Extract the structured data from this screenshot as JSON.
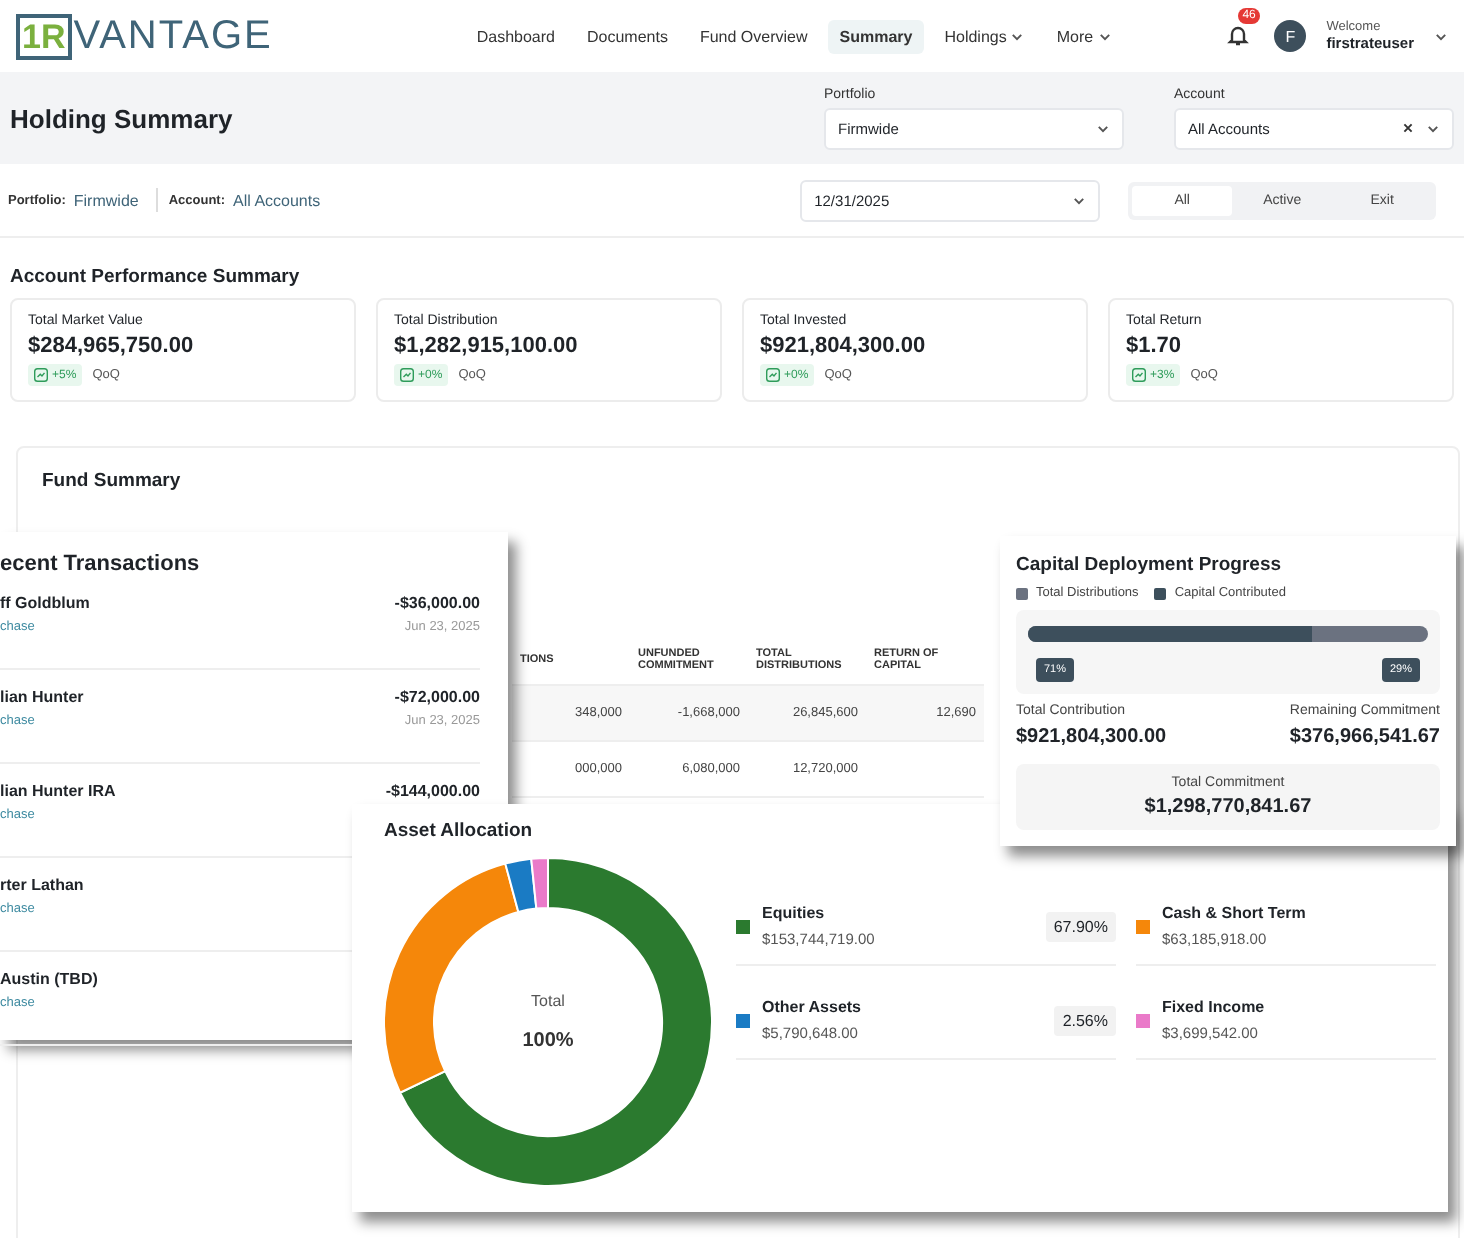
{
  "header": {
    "logo": {
      "mark": "1R",
      "text": "VANTAGE"
    },
    "nav": [
      {
        "label": "Dashboard",
        "selected": false,
        "dropdown": false
      },
      {
        "label": "Documents",
        "selected": false,
        "dropdown": false
      },
      {
        "label": "Fund Overview",
        "selected": false,
        "dropdown": false
      },
      {
        "label": "Summary",
        "selected": true,
        "dropdown": false
      },
      {
        "label": "Holdings",
        "selected": false,
        "dropdown": true
      },
      {
        "label": "More",
        "selected": false,
        "dropdown": true
      }
    ],
    "notifications": "46",
    "user": {
      "initial": "F",
      "greeting": "Welcome",
      "name": "firstrateuser"
    }
  },
  "page": {
    "title": "Holding Summary",
    "portfolio": {
      "label": "Portfolio",
      "value": "Firmwide"
    },
    "account": {
      "label": "Account",
      "value": "All Accounts"
    }
  },
  "filter": {
    "portfolio_label": "Portfolio:",
    "portfolio": "Firmwide",
    "account_label": "Account:",
    "account": "All Accounts",
    "date": "12/31/2025",
    "segments": [
      {
        "label": "All",
        "selected": true
      },
      {
        "label": "Active",
        "selected": false
      },
      {
        "label": "Exit",
        "selected": false
      }
    ]
  },
  "performance": {
    "title": "Account Performance Summary",
    "cards": [
      {
        "label": "Total Market Value",
        "value": "$284,965,750.00",
        "change": "+5%",
        "period": "QoQ"
      },
      {
        "label": "Total Distribution",
        "value": "$1,282,915,100.00",
        "change": "+0%",
        "period": "QoQ"
      },
      {
        "label": "Total Invested",
        "value": "$921,804,300.00",
        "change": "+0%",
        "period": "QoQ"
      },
      {
        "label": "Total Return",
        "value": "$1.70",
        "change": "+3%",
        "period": "QoQ"
      }
    ]
  },
  "fund_summary": {
    "title": "Fund Summary",
    "table": {
      "columns": [
        "TIONS",
        "UNFUNDED COMMITMENT",
        "TOTAL DISTRIBUTIONS",
        "RETURN OF CAPITAL"
      ],
      "rows": [
        [
          "348,000",
          "-1,668,000",
          "26,845,600",
          "12,690"
        ],
        [
          "000,000",
          "6,080,000",
          "12,720,000",
          ""
        ]
      ]
    }
  },
  "transactions": {
    "title": "ecent Transactions",
    "items": [
      {
        "name": "ff Goldblum",
        "type": "chase",
        "amount": "-$36,000.00",
        "date": "Jun 23, 2025"
      },
      {
        "name": "lian Hunter",
        "type": "chase",
        "amount": "-$72,000.00",
        "date": "Jun 23, 2025"
      },
      {
        "name": "lian Hunter IRA",
        "type": "chase",
        "amount": "-$144,000.00"
      },
      {
        "name": "rter Lathan",
        "type": "chase"
      },
      {
        "name": "Austin (TBD)",
        "type": "chase"
      }
    ]
  },
  "capital": {
    "title": "Capital Deployment Progress",
    "legend": [
      {
        "label": "Total Distributions",
        "color": "#6b7280"
      },
      {
        "label": "Capital Contributed",
        "color": "#3d4f5c"
      }
    ],
    "level": 0.71,
    "left_label": "71%",
    "right_label": "29%",
    "contribution": {
      "label": "Total Contribution",
      "value": "$921,804,300.00"
    },
    "remaining": {
      "label": "Remaining Commitment",
      "value": "$376,966,541.67"
    },
    "commitment": {
      "label": "Total Commitment",
      "value": "$1,298,770,841.67"
    }
  },
  "allocation": {
    "title": "Asset Allocation",
    "center_label": "Total",
    "center_value": "100%",
    "chart_data": {
      "type": "donut",
      "categories": [
        "Equities",
        "Cash & Short Term",
        "Other Assets",
        "Fixed Income"
      ],
      "values": [
        67.9,
        27.91,
        2.56,
        1.63
      ]
    },
    "legend": [
      {
        "color": "#2b7a2f",
        "amount": "$153,744,719.00",
        "percent": "67.90%"
      },
      {
        "color": "#f5870a",
        "amount": "$63,185,918.00"
      },
      {
        "color": "#1a7bc4",
        "amount": "$5,790,648.00",
        "percent": "2.56%"
      },
      {
        "color": "#ea7ac9",
        "amount": "$3,699,542.00"
      }
    ]
  }
}
